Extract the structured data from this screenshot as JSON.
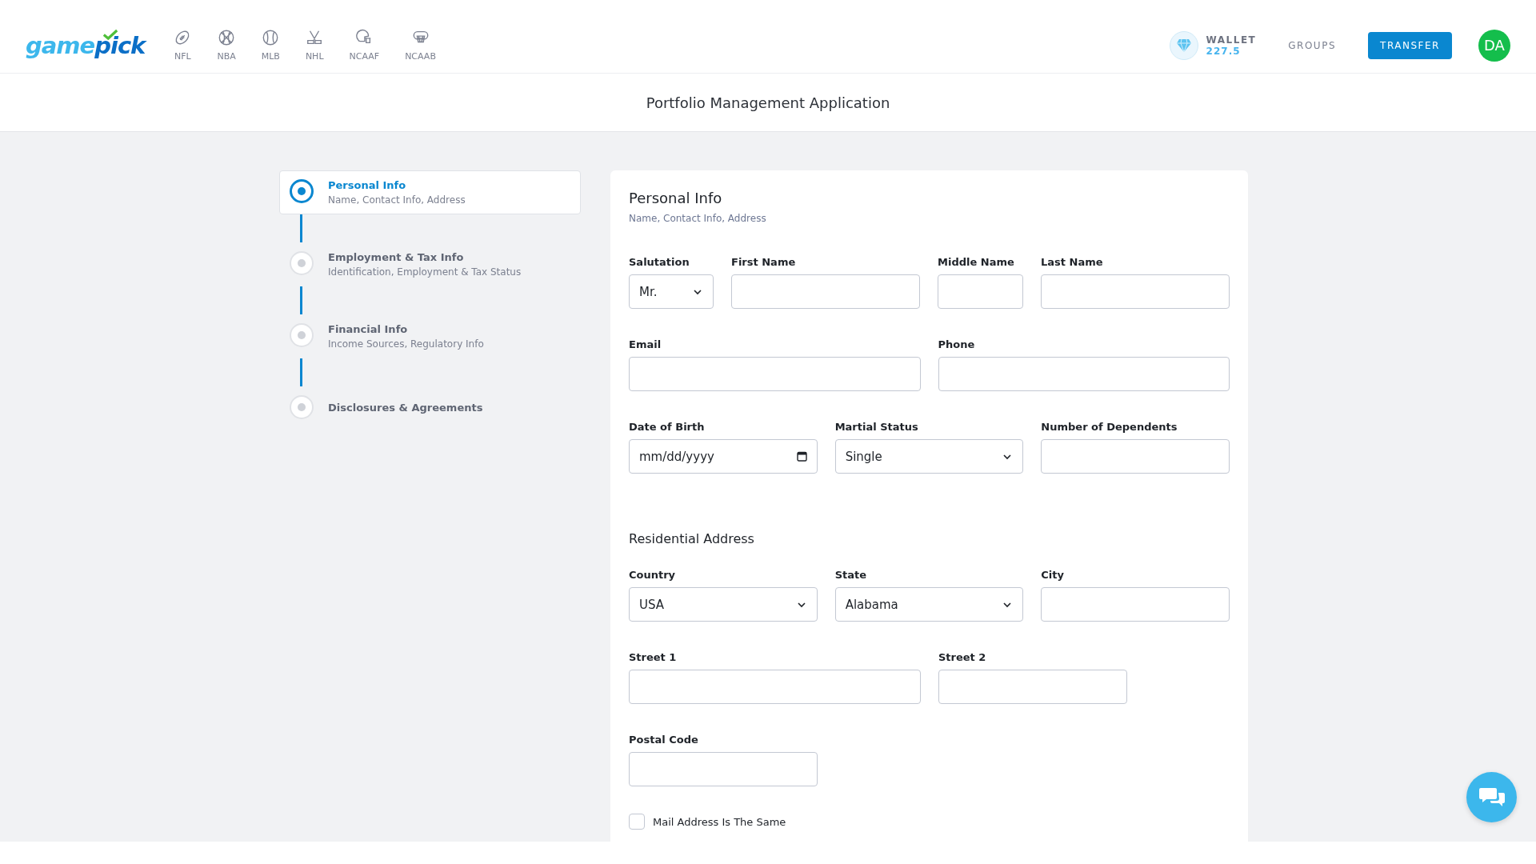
{
  "header": {
    "logo": {
      "part1": "game",
      "part2": "pick"
    },
    "nav": [
      {
        "label": "NFL"
      },
      {
        "label": "NBA"
      },
      {
        "label": "MLB"
      },
      {
        "label": "NHL"
      },
      {
        "label": "NCAAF"
      },
      {
        "label": "NCAAB"
      }
    ],
    "wallet": {
      "label": "WALLET",
      "amount": "227.5"
    },
    "groups": "GROUPS",
    "transfer": "TRANSFER",
    "avatar": "DA"
  },
  "page_title": "Portfolio Management Application",
  "steps": [
    {
      "title": "Personal Info",
      "subtitle": "Name, Contact Info, Address",
      "selected": true
    },
    {
      "title": "Employment & Tax Info",
      "subtitle": "Identification, Employment & Tax Status",
      "selected": false
    },
    {
      "title": "Financial Info",
      "subtitle": "Income Sources, Regulatory Info",
      "selected": false
    },
    {
      "title": "Disclosures & Agreements",
      "selected": false
    }
  ],
  "form": {
    "title": "Personal Info",
    "subtitle": "Name, Contact Info, Address",
    "rows": [
      {
        "fields": [
          {
            "label": "Salutation",
            "kind": "select",
            "value": "Mr."
          },
          {
            "label": "First Name",
            "kind": "text"
          },
          {
            "label": "Middle Name",
            "kind": "text"
          },
          {
            "label": "Last Name",
            "kind": "text"
          }
        ]
      },
      {
        "fields": [
          {
            "label": "Email",
            "kind": "text"
          },
          {
            "label": "Phone",
            "kind": "text"
          }
        ]
      },
      {
        "fields": [
          {
            "label": "Date of Birth",
            "kind": "date",
            "placeholder": "mm/dd/yyyy"
          },
          {
            "label": "Martial Status",
            "kind": "select",
            "value": "Single"
          },
          {
            "label": "Number of Dependents",
            "kind": "text"
          }
        ]
      }
    ],
    "address_title": "Residential Address",
    "address_rows": [
      {
        "fields": [
          {
            "label": "Country",
            "kind": "select",
            "value": "USA"
          },
          {
            "label": "State",
            "kind": "select",
            "value": "Alabama"
          },
          {
            "label": "City",
            "kind": "text"
          }
        ]
      },
      {
        "fields": [
          {
            "label": "Street 1",
            "kind": "text"
          },
          {
            "label": "Street 2",
            "kind": "text"
          }
        ]
      },
      {
        "fields": [
          {
            "label": "Postal Code",
            "kind": "text"
          }
        ]
      }
    ],
    "mail_same": {
      "label": "Mail Address Is The Same",
      "checked": false
    }
  }
}
